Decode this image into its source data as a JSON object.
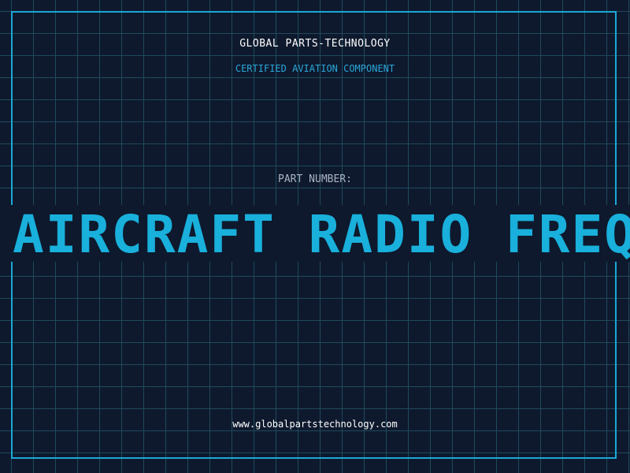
{
  "header": {
    "brand": "GLOBAL PARTS-TECHNOLOGY",
    "subtitle": "CERTIFIED AVIATION COMPONENT"
  },
  "part": {
    "label": "PART NUMBER:",
    "name": "AIRCRAFT RADIO FREQUENCY"
  },
  "footer": {
    "website": "www.globalpartstechnology.com"
  },
  "colors": {
    "background": "#0e192d",
    "grid": "#1f4a5c",
    "accent": "#1ba8d6",
    "text": "#ffffff",
    "muted": "#a9b4c4"
  }
}
